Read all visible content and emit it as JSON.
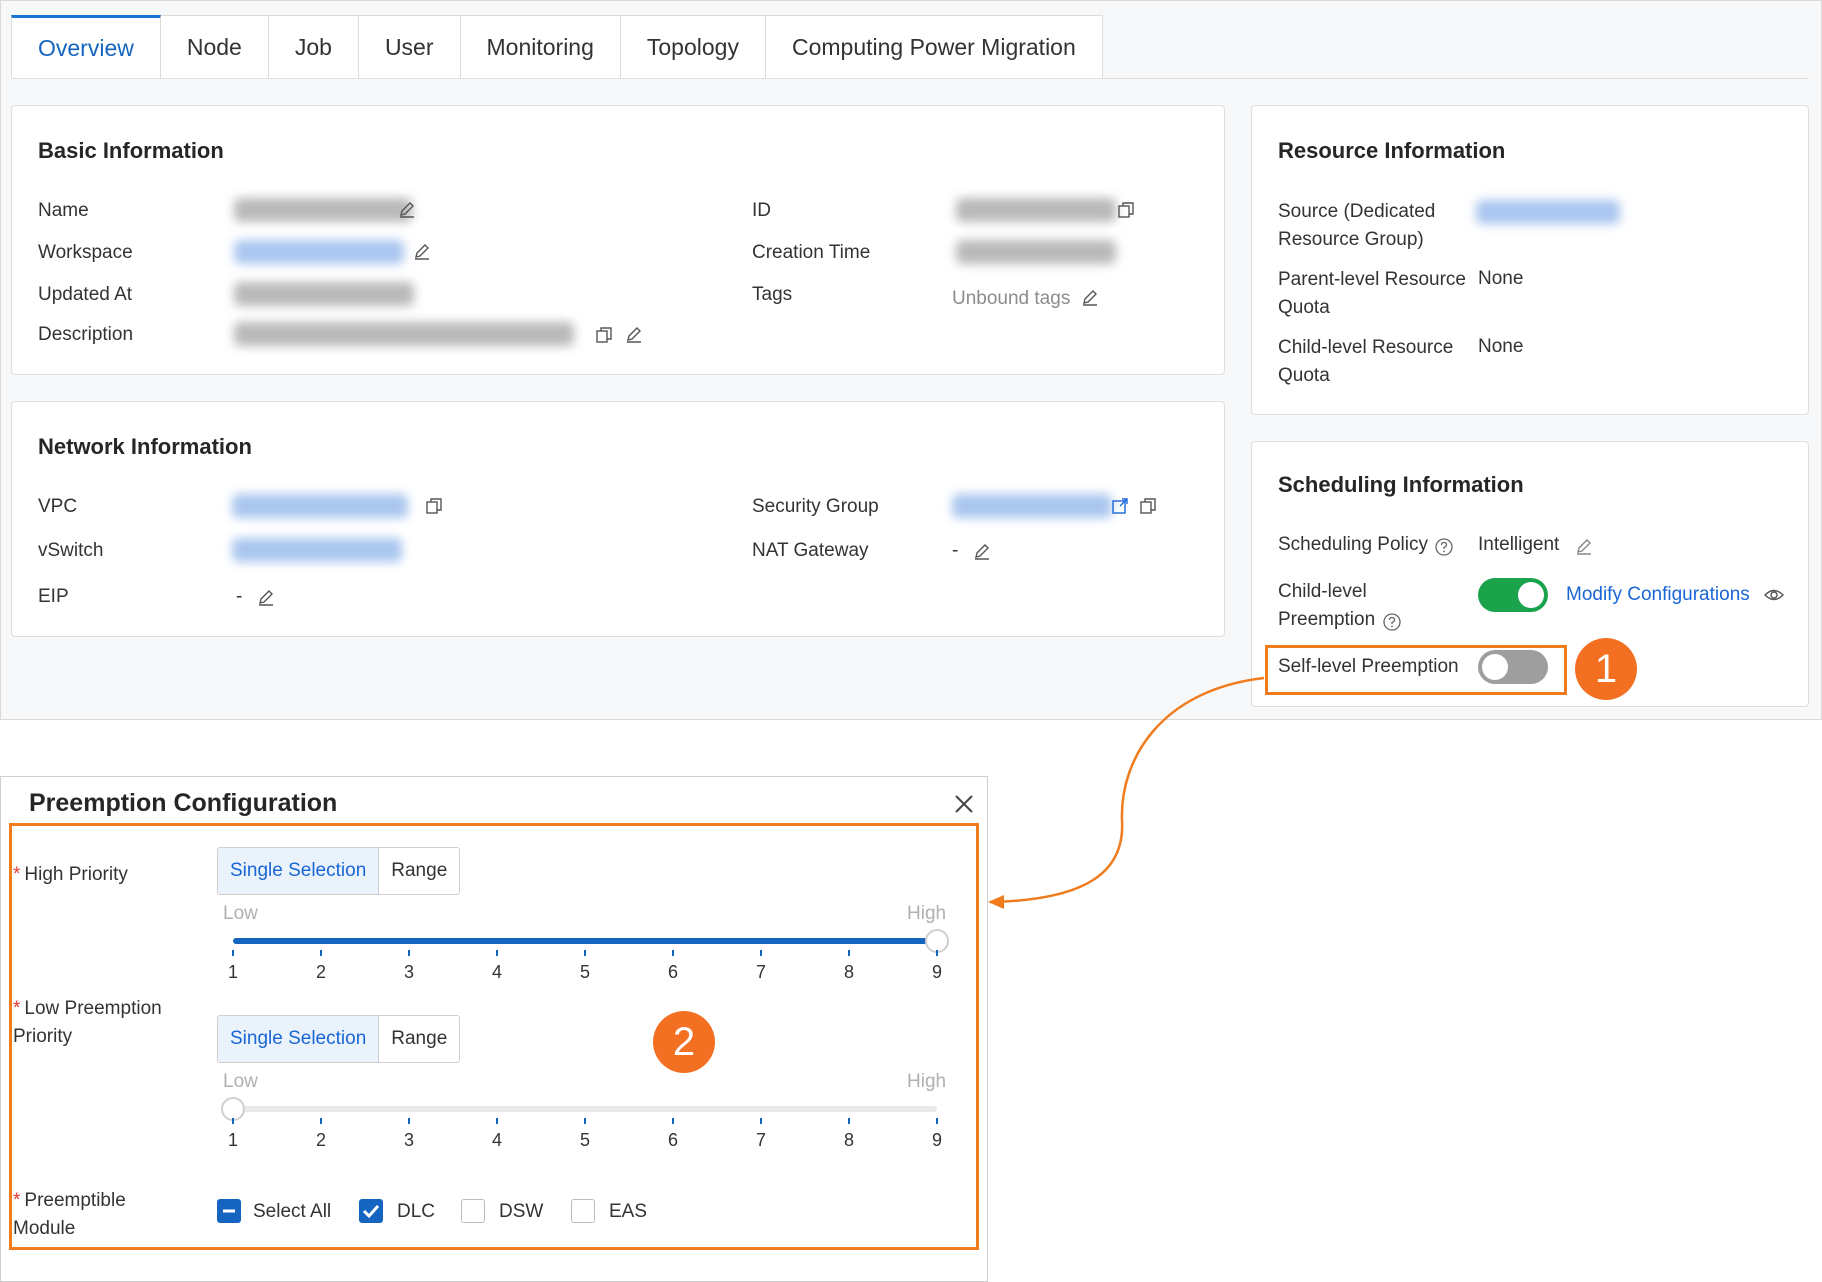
{
  "tabs": [
    {
      "label": "Overview",
      "active": true
    },
    {
      "label": "Node"
    },
    {
      "label": "Job"
    },
    {
      "label": "User"
    },
    {
      "label": "Monitoring"
    },
    {
      "label": "Topology"
    },
    {
      "label": "Computing Power Migration"
    }
  ],
  "basic": {
    "title": "Basic Information",
    "name_label": "Name",
    "workspace_label": "Workspace",
    "updated_label": "Updated At",
    "description_label": "Description",
    "id_label": "ID",
    "creation_label": "Creation Time",
    "tags_label": "Tags",
    "tags_value": "Unbound tags"
  },
  "network": {
    "title": "Network Information",
    "vpc_label": "VPC",
    "vswitch_label": "vSwitch",
    "eip_label": "EIP",
    "eip_value": "-",
    "security_label": "Security Group",
    "nat_label": "NAT Gateway",
    "nat_value": "-"
  },
  "resource": {
    "title": "Resource Information",
    "source_label_1": "Source (Dedicated",
    "source_label_2": "Resource Group)",
    "parent_label_1": "Parent-level Resource",
    "parent_label_2": "Quota",
    "parent_value": "None",
    "child_label_1": "Child-level Resource",
    "child_label_2": "Quota",
    "child_value": "None"
  },
  "scheduling": {
    "title": "Scheduling Information",
    "policy_label": "Scheduling Policy",
    "policy_value": "Intelligent",
    "child_pre_label_1": "Child-level",
    "child_pre_label_2": "Preemption",
    "child_pre_on": true,
    "modify_link": "Modify Configurations",
    "self_pre_label": "Self-level Preemption",
    "self_pre_on": false
  },
  "callouts": {
    "one": "1",
    "two": "2",
    "color": "#f36f21"
  },
  "dialog": {
    "title": "Preemption Configuration",
    "high": {
      "label": "High Priority",
      "seg_single": "Single Selection",
      "seg_range": "Range",
      "low_text": "Low",
      "high_text": "High",
      "value": 9
    },
    "low": {
      "label_1": "Low Preemption",
      "label_2": "Priority",
      "seg_single": "Single Selection",
      "seg_range": "Range",
      "low_text": "Low",
      "high_text": "High",
      "value": 1
    },
    "ticks": [
      "1",
      "2",
      "3",
      "4",
      "5",
      "6",
      "7",
      "8",
      "9"
    ],
    "module": {
      "label_1": "Preemptible",
      "label_2": "Module",
      "options": [
        {
          "label": "Select All",
          "state": "partial"
        },
        {
          "label": "DLC",
          "state": "checked"
        },
        {
          "label": "DSW",
          "state": "empty"
        },
        {
          "label": "EAS",
          "state": "empty"
        }
      ]
    }
  },
  "colors": {
    "accent": "#1565c0",
    "link": "#1a66d6",
    "toggle_on": "#1aa34a",
    "callout": "#f07c1e"
  }
}
